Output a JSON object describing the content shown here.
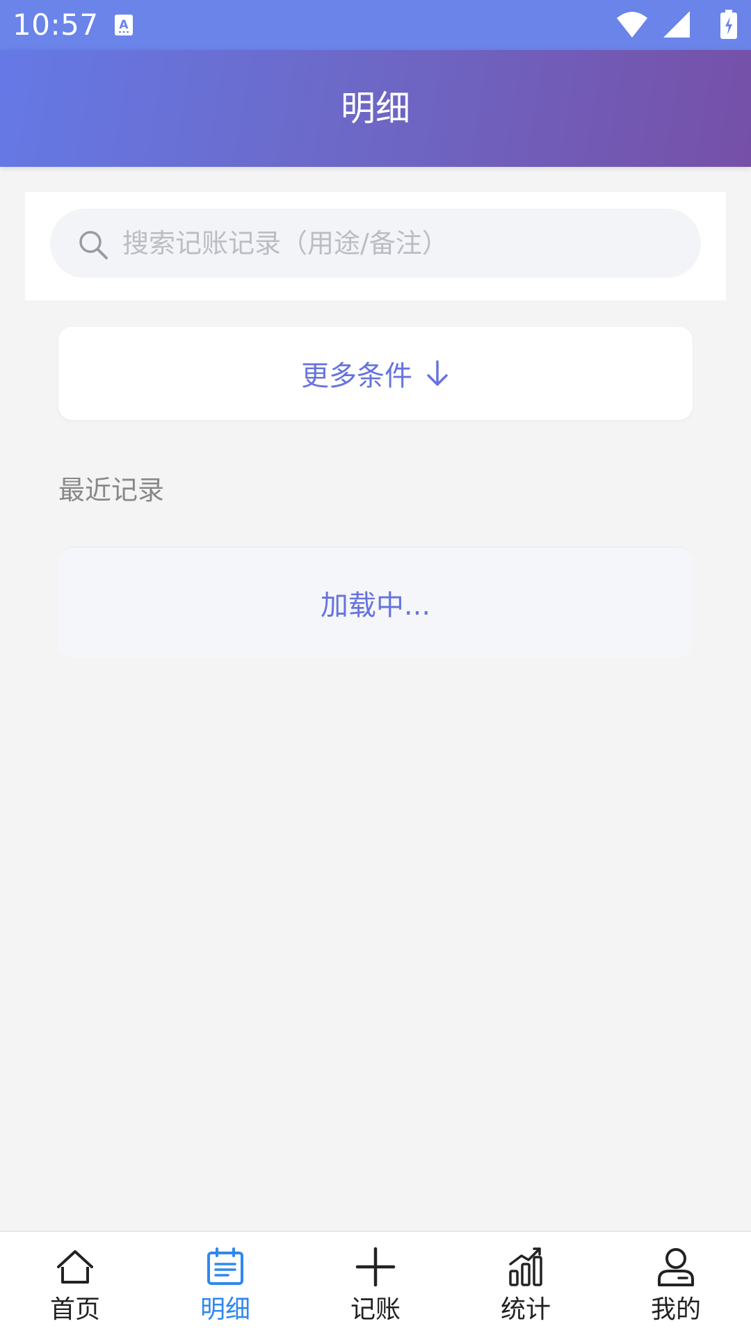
{
  "status_bar": {
    "time": "10:57"
  },
  "header": {
    "title": "明细"
  },
  "search": {
    "placeholder": "搜索记账记录（用途/备注）",
    "value": ""
  },
  "filters": {
    "more_label": "更多条件"
  },
  "recent": {
    "title": "最近记录",
    "loading_text": "加载中..."
  },
  "bottom_nav": {
    "active": 1,
    "items": [
      {
        "label": "首页",
        "icon": "home-icon"
      },
      {
        "label": "明细",
        "icon": "list-icon"
      },
      {
        "label": "记账",
        "icon": "plus-icon"
      },
      {
        "label": "统计",
        "icon": "chart-icon"
      },
      {
        "label": "我的",
        "icon": "profile-icon"
      }
    ]
  },
  "colors": {
    "status_bar": "#6a84ea",
    "accent": "#6673df",
    "nav_active": "#2f87f0",
    "background": "#f4f4f5"
  }
}
